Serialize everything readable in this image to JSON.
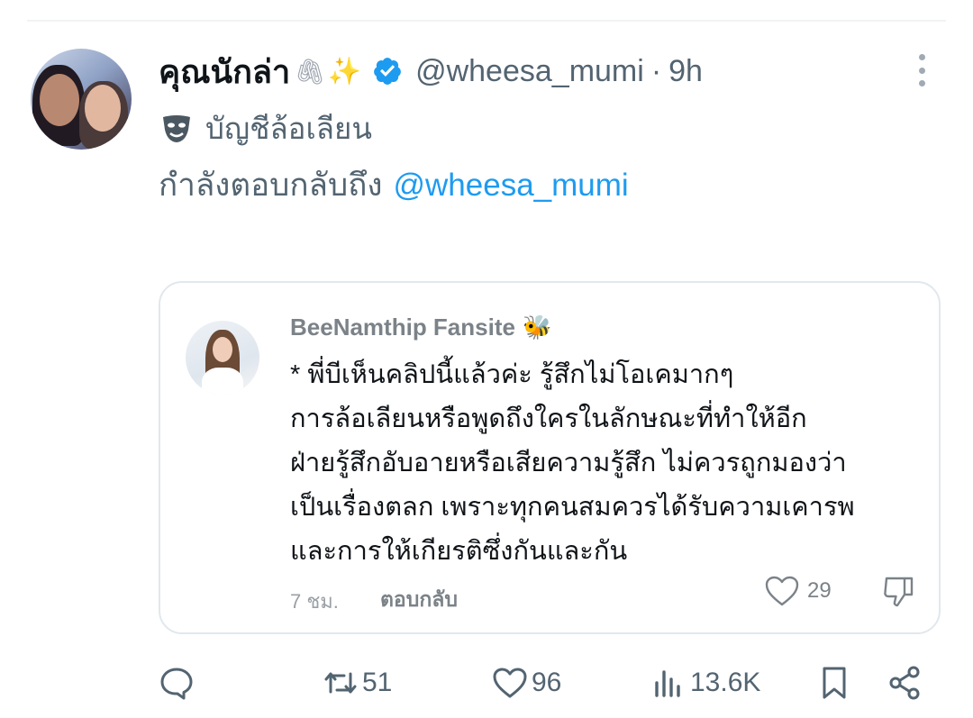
{
  "post": {
    "display_name": "คุณนักล่า",
    "emoji_clips": "🖇",
    "emoji_sparkles": "✨",
    "handle": "@wheesa_mumi",
    "separator": "·",
    "time": "9h",
    "account_label": "บัญชีล้อเลียน",
    "replying_to_prefix": "กำลังตอบกลับถึง",
    "replying_to_handle": "@wheesa_mumi"
  },
  "embedded": {
    "author_name": "BeeNamthip Fansite",
    "author_emoji": "🐝",
    "body_lines": [
      "* พี่บีเห็นคลิปนี้แล้วค่ะ รู้สึกไม่โอเคมากๆ",
      "การล้อเลียนหรือพูดถึงใครในลักษณะที่ทำให้อีก",
      "ฝ่ายรู้สึกอับอายหรือเสียความรู้สึก ไม่ควรถูกมองว่า",
      "เป็นเรื่องตลก เพราะทุกคนสมควรได้รับความเคารพ",
      "และการให้เกียรติซึ่งกันและกัน"
    ],
    "time": "7 ชม.",
    "reply_label": "ตอบกลับ",
    "likes": "29"
  },
  "actions": {
    "retweets": "51",
    "likes": "96",
    "views": "13.6K"
  },
  "colors": {
    "accent": "#1d9bf0",
    "secondary_text": "#536471",
    "verified": "#1d9bf0"
  },
  "icons": [
    "more-icon",
    "verified-badge-icon",
    "mask-icon",
    "heart-icon",
    "dislike-icon",
    "reply-icon",
    "retweet-icon",
    "like-icon",
    "views-icon",
    "bookmark-icon",
    "share-icon"
  ]
}
